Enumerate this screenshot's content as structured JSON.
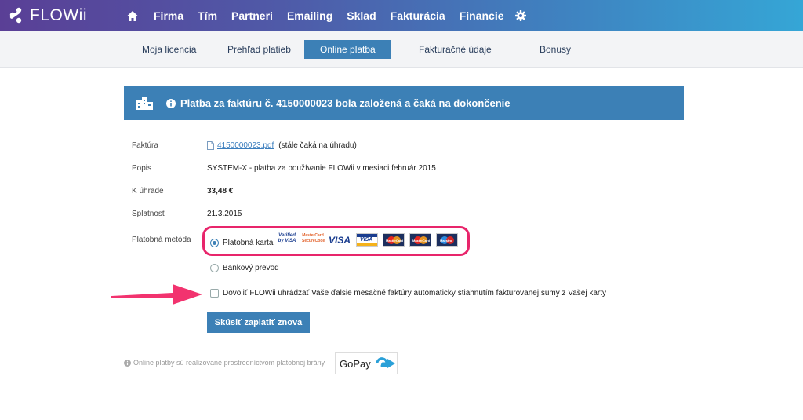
{
  "app": {
    "logo_text": "FLOWii"
  },
  "nav": {
    "home_icon": "home-icon",
    "items": [
      "Firma",
      "Tím",
      "Partneri",
      "Emailing",
      "Sklad",
      "Fakturácia",
      "Financie"
    ],
    "settings_icon": "gear-icon"
  },
  "subnav": {
    "tabs": [
      "Moja licencia",
      "Prehľad platieb",
      "Online platba",
      "Fakturačné údaje",
      "Bonusy"
    ],
    "active": "Online platba"
  },
  "banner": {
    "icon": "info-icon",
    "text": "Platba za faktúru č. 4150000023 bola založená a čaká na dokončenie"
  },
  "details": {
    "invoice_label": "Faktúra",
    "invoice_link": "4150000023.pdf",
    "invoice_status": "(stále čaká na úhradu)",
    "description_label": "Popis",
    "description_value": "SYSTEM-X - platba za používanie FLOWii v mesiaci február 2015",
    "amount_label": "K úhrade",
    "amount_value": "33,48 €",
    "due_label": "Splatnosť",
    "due_value": "21.3.2015",
    "method_label": "Platobná metóda"
  },
  "payment": {
    "card_option": "Platobná karta",
    "card_checked": true,
    "card_logos": [
      "Verified by VISA",
      "MasterCard SecureCode",
      "VISA",
      "VISA",
      "MasterCard",
      "MasterCard",
      "Maestro"
    ],
    "bank_option": "Bankový prevod",
    "bank_checked": false,
    "auto_pay_label": "Dovoliť FLOWii uhrádzať Vaše ďalsie mesačné faktúry automaticky stiahnutím fakturovanej sumy z Vašej karty",
    "auto_pay_checked": false,
    "retry_button": "Skúsiť zaplatiť znova"
  },
  "footer": {
    "note": "Online platby sú realizované prostredníctvom platobnej brány",
    "gateway": "GoPay"
  },
  "colors": {
    "accent": "#3c80b6",
    "highlight": "#e8256b",
    "arrow": "#f2336f"
  }
}
